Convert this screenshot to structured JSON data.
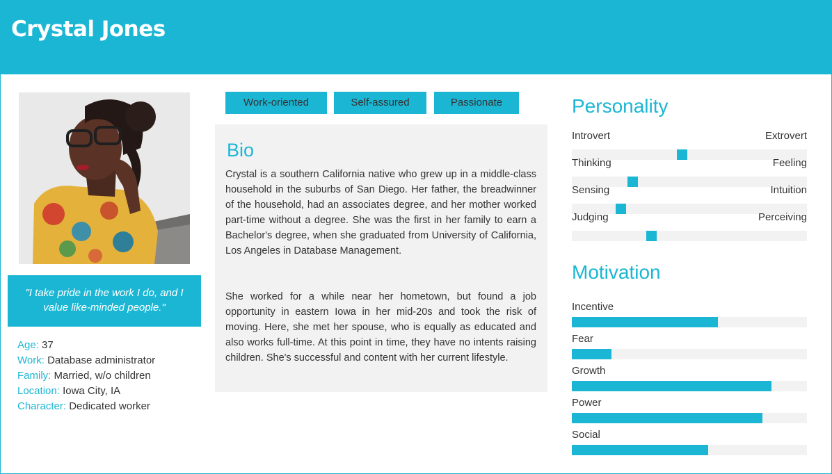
{
  "persona": {
    "name": "Crystal Jones",
    "quote": "\"I take pride in the work I do, and I value like-minded people.\""
  },
  "facts": [
    {
      "key": "Age:",
      "value": "37"
    },
    {
      "key": "Work:",
      "value": "Database administrator"
    },
    {
      "key": "Family:",
      "value": "Married, w/o children"
    },
    {
      "key": "Location:",
      "value": "Iowa City, IA"
    },
    {
      "key": "Character:",
      "value": "Dedicated worker"
    }
  ],
  "tags": [
    "Work-oriented",
    "Self-assured",
    "Passionate"
  ],
  "bio": {
    "title": "Bio",
    "paragraphs": [
      "Crystal is a southern California native who grew up in a middle-class household in the suburbs of San Diego. Her father, the breadwinner of the household, had an associates degree, and her mother worked part-time without a degree. She was the first in her family to earn a Bachelor's degree, when she graduated from University of California, Los Angeles in Database Management.",
      "She worked for a while near her hometown, but found a job opportunity in eastern Iowa in her mid-20s and took the risk of moving. Here, she met her spouse, who is equally as educated and also works full-time. At this point in time, they have no intents raising children. She's successful and content with her current lifestyle."
    ]
  },
  "personality": {
    "title": "Personality",
    "traits": [
      {
        "left": "Introvert",
        "right": "Extrovert",
        "level": 0.47
      },
      {
        "left": "Thinking",
        "right": "Feeling",
        "level": 0.26
      },
      {
        "left": "Sensing",
        "right": "Intuition",
        "level": 0.21
      },
      {
        "left": "Judging",
        "right": "Perceiving",
        "level": 0.34
      }
    ]
  },
  "motivation": {
    "title": "Motivation",
    "items": [
      {
        "label": "Incentive",
        "level": 0.62
      },
      {
        "label": "Fear",
        "level": 0.17
      },
      {
        "label": "Growth",
        "level": 0.85
      },
      {
        "label": "Power",
        "level": 0.81
      },
      {
        "label": "Social",
        "level": 0.58
      }
    ]
  },
  "colors": {
    "accent": "#1bb6d4",
    "panel": "#f2f2f2",
    "text": "#333333"
  }
}
